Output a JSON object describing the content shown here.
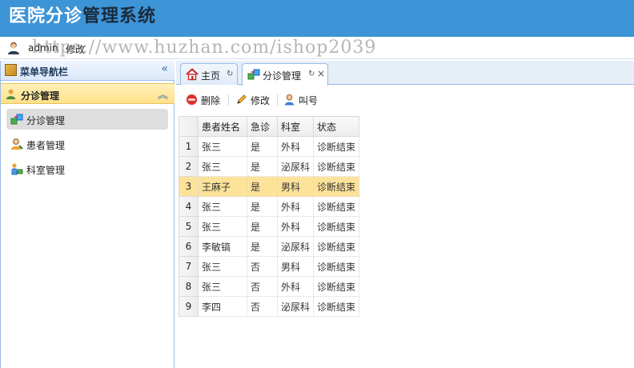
{
  "header": {
    "title_part1": "医院分诊",
    "title_part2": "管理系统",
    "bg_color": "#3d94d6"
  },
  "userbar": {
    "username": "admin",
    "logout_label": "修改",
    "watermark": "https://www.huzhan.com/ishop2039"
  },
  "sidebar": {
    "title": "菜单导航栏",
    "collapse_icon": "double-chevron-left-icon",
    "group": {
      "title": "分诊管理",
      "collapse_icon": "double-chevron-up-icon"
    },
    "items": [
      {
        "label": "分诊管理",
        "icon": "triage-icon",
        "active": true
      },
      {
        "label": "患者管理",
        "icon": "patient-icon",
        "active": false
      },
      {
        "label": "科室管理",
        "icon": "department-icon",
        "active": false
      }
    ]
  },
  "tabs": [
    {
      "label": "主页",
      "icon": "home-icon",
      "refresh": "↻",
      "active": false
    },
    {
      "label": "分诊管理",
      "icon": "triage-icon",
      "refresh": "↻",
      "close": "×",
      "active": true
    }
  ],
  "toolbar": {
    "delete_label": "删除",
    "edit_label": "修改",
    "call_label": "叫号"
  },
  "table": {
    "columns": [
      "患者姓名",
      "急诊",
      "科室",
      "状态"
    ],
    "rows": [
      {
        "num": "1",
        "name": "张三",
        "emergency": "是",
        "dept": "外科",
        "status": "诊断结束"
      },
      {
        "num": "2",
        "name": "张三",
        "emergency": "是",
        "dept": "泌尿科",
        "status": "诊断结束"
      },
      {
        "num": "3",
        "name": "王麻子",
        "emergency": "是",
        "dept": "男科",
        "status": "诊断结束"
      },
      {
        "num": "4",
        "name": "张三",
        "emergency": "是",
        "dept": "外科",
        "status": "诊断结束"
      },
      {
        "num": "5",
        "name": "张三",
        "emergency": "是",
        "dept": "外科",
        "status": "诊断结束"
      },
      {
        "num": "6",
        "name": "李敏镐",
        "emergency": "是",
        "dept": "泌尿科",
        "status": "诊断结束"
      },
      {
        "num": "7",
        "name": "张三",
        "emergency": "否",
        "dept": "男科",
        "status": "诊断结束"
      },
      {
        "num": "8",
        "name": "张三",
        "emergency": "否",
        "dept": "外科",
        "status": "诊断结束"
      },
      {
        "num": "9",
        "name": "李四",
        "emergency": "否",
        "dept": "泌尿科",
        "status": "诊断结束"
      }
    ],
    "selected_row": 3,
    "selected_color": "#fde39a"
  }
}
